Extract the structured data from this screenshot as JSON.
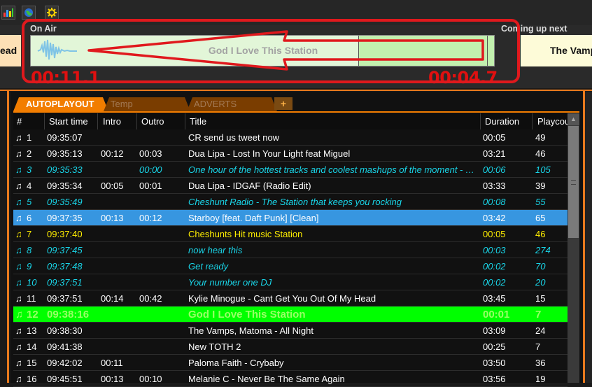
{
  "toolbar": {
    "icons": [
      "bar-chart-icon",
      "globe-icon",
      "gear-icon"
    ]
  },
  "prev_deck": {
    "text": "ead"
  },
  "on_air": {
    "label": "On Air",
    "title": "God I Love This Station",
    "elapsed": "00:11.1",
    "remaining": "00:04.7"
  },
  "coming_up": {
    "label": "Coming up next",
    "text": "The Vamps"
  },
  "tabs": [
    {
      "label": "AUTOPLAYOUT",
      "active": true
    },
    {
      "label": "Temp",
      "active": false
    },
    {
      "label": "ADVERTS",
      "active": false
    }
  ],
  "tab_add_label": "+",
  "columns": [
    "#",
    "Start time",
    "Intro",
    "Outro",
    "Title",
    "Duration",
    "Playcount"
  ],
  "colors": {
    "normal": "#ffffff",
    "jingle": "#19d5e8",
    "station_id": "#ffee00",
    "selected_bg": "#3796e0",
    "playing_bg": "#00ff00",
    "playing_fg": "#99ff66",
    "accent": "#f27d00",
    "timer": "#e01010"
  },
  "rows": [
    {
      "num": "1",
      "start": "09:35:07",
      "intro": "",
      "outro": "",
      "title": "CR send us tweet now",
      "duration": "00:05",
      "playcount": "49",
      "kind": "normal"
    },
    {
      "num": "2",
      "start": "09:35:13",
      "intro": "00:12",
      "outro": "00:03",
      "title": "Dua Lipa - Lost In Your Light feat Miguel",
      "duration": "03:21",
      "playcount": "46",
      "kind": "normal"
    },
    {
      "num": "3",
      "start": "09:35:33",
      "intro": "",
      "outro": "00:00",
      "title": "One hour of the hottest tracks and coolest mashups of the moment - Cheshunt Radio",
      "duration": "00:06",
      "playcount": "105",
      "kind": "jingle"
    },
    {
      "num": "4",
      "start": "09:35:34",
      "intro": "00:05",
      "outro": "00:01",
      "title": "Dua Lipa - IDGAF (Radio Edit)",
      "duration": "03:33",
      "playcount": "39",
      "kind": "normal"
    },
    {
      "num": "5",
      "start": "09:35:49",
      "intro": "",
      "outro": "",
      "title": "Cheshunt Radio - The Station that keeps you rocking",
      "duration": "00:08",
      "playcount": "55",
      "kind": "jingle"
    },
    {
      "num": "6",
      "start": "09:37:35",
      "intro": "00:13",
      "outro": "00:12",
      "title": "Starboy [feat. Daft Punk] [Clean]",
      "duration": "03:42",
      "playcount": "65",
      "kind": "selected"
    },
    {
      "num": "7",
      "start": "09:37:40",
      "intro": "",
      "outro": "",
      "title": "Cheshunts Hit music Station",
      "duration": "00:05",
      "playcount": "46",
      "kind": "station"
    },
    {
      "num": "8",
      "start": "09:37:45",
      "intro": "",
      "outro": "",
      "title": "now hear this",
      "duration": "00:03",
      "playcount": "274",
      "kind": "jingle"
    },
    {
      "num": "9",
      "start": "09:37:48",
      "intro": "",
      "outro": "",
      "title": "Get ready",
      "duration": "00:02",
      "playcount": "70",
      "kind": "jingle"
    },
    {
      "num": "10",
      "start": "09:37:51",
      "intro": "",
      "outro": "",
      "title": "Your number one DJ",
      "duration": "00:02",
      "playcount": "20",
      "kind": "jingle"
    },
    {
      "num": "11",
      "start": "09:37:51",
      "intro": "00:14",
      "outro": "00:42",
      "title": "Kylie Minogue - Cant Get You Out Of My Head",
      "duration": "03:45",
      "playcount": "15",
      "kind": "normal"
    },
    {
      "num": "12",
      "start": "09:38:16",
      "intro": "",
      "outro": "",
      "title": "God I Love This Station",
      "duration": "00:01",
      "playcount": "7",
      "kind": "playing"
    },
    {
      "num": "13",
      "start": "09:38:30",
      "intro": "",
      "outro": "",
      "title": "The Vamps, Matoma - All Night",
      "duration": "03:09",
      "playcount": "24",
      "kind": "normal"
    },
    {
      "num": "14",
      "start": "09:41:38",
      "intro": "",
      "outro": "",
      "title": "New TOTH 2",
      "duration": "00:25",
      "playcount": "7",
      "kind": "normal"
    },
    {
      "num": "15",
      "start": "09:42:02",
      "intro": "00:11",
      "outro": "",
      "title": "Paloma Faith - Crybaby",
      "duration": "03:50",
      "playcount": "36",
      "kind": "normal"
    },
    {
      "num": "16",
      "start": "09:45:51",
      "intro": "00:13",
      "outro": "00:10",
      "title": "Melanie C - Never Be The Same Again",
      "duration": "03:56",
      "playcount": "19",
      "kind": "normal"
    }
  ]
}
